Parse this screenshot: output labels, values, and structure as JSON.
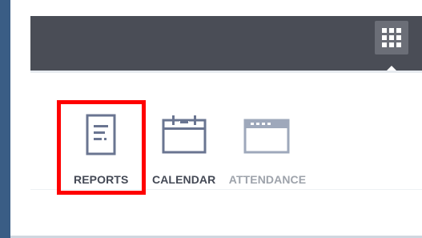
{
  "toolbar": {
    "apps_icon": "grid-icon",
    "bar_color": "#4a4d56"
  },
  "apps": [
    {
      "label": "REPORTS",
      "icon": "reports-icon",
      "highlighted": true
    },
    {
      "label": "CALENDAR",
      "icon": "calendar-icon",
      "highlighted": false
    },
    {
      "label": "ATTENDANCE",
      "icon": "attendance-icon",
      "highlighted": false
    }
  ],
  "colors": {
    "highlight": "#ff0000",
    "icon": "#6a7591",
    "icon_light": "#9ea8bb",
    "desktop": "#3a5d85"
  }
}
